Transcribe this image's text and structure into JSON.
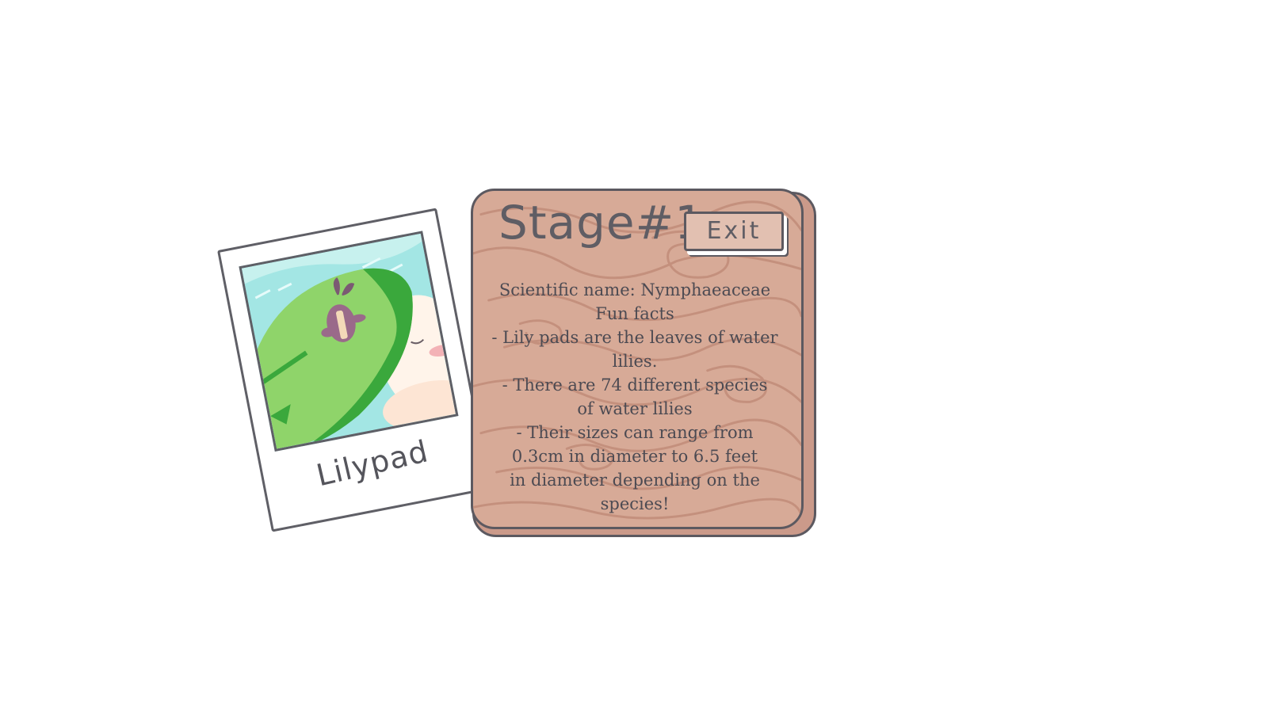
{
  "polaroid": {
    "caption": "Lilypad"
  },
  "board": {
    "title": "Stage#1",
    "exit_label": "Exit",
    "scientific_name_line": "Scientific name: Nymphaeaceae",
    "fun_facts_heading": "Fun facts",
    "fact_1_line_1": "- Lily pads are the leaves of water",
    "fact_1_line_2": "lilies.",
    "fact_2_line_1": "- There are 74 different species",
    "fact_2_line_2": "of water lilies",
    "fact_3_line_1": "- Their sizes can range from",
    "fact_3_line_2": "0.3cm in diameter to 6.5 feet",
    "fact_3_line_3": "in diameter depending on the",
    "fact_3_line_4": "species!"
  },
  "colors": {
    "wood": "#d7aa97",
    "wood_grain": "#c28f7d",
    "outline": "#5c5960",
    "lilypad_green": "#8fd46a",
    "water": "#9fe3e3"
  }
}
